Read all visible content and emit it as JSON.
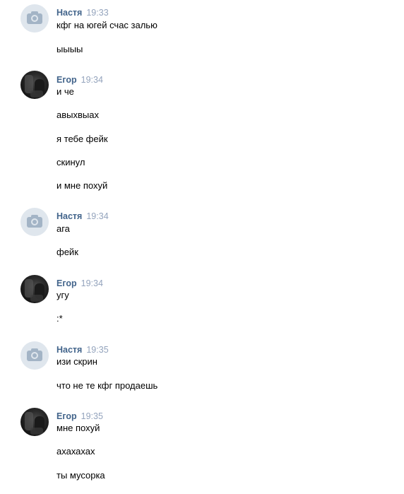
{
  "messages": [
    {
      "author": "Настя",
      "time": "19:33",
      "avatar": "camera-placeholder-icon",
      "lines": [
        "кфг на югей счас залью",
        "ыыыы"
      ]
    },
    {
      "author": "Егор",
      "time": "19:34",
      "avatar": "user-photo",
      "lines": [
        "и че",
        "авыхвыах",
        "я тебе фейк",
        "скинул",
        "и мне похуй"
      ]
    },
    {
      "author": "Настя",
      "time": "19:34",
      "avatar": "camera-placeholder-icon",
      "lines": [
        "ага",
        "фейк"
      ]
    },
    {
      "author": "Егор",
      "time": "19:34",
      "avatar": "user-photo",
      "lines": [
        "угу",
        ":*"
      ]
    },
    {
      "author": "Настя",
      "time": "19:35",
      "avatar": "camera-placeholder-icon",
      "lines": [
        "изи скрин",
        "что не те кфг продаешь"
      ]
    },
    {
      "author": "Егор",
      "time": "19:35",
      "avatar": "user-photo",
      "lines": [
        "мне похуй",
        "ахахахах",
        "ты мусорка"
      ]
    }
  ]
}
